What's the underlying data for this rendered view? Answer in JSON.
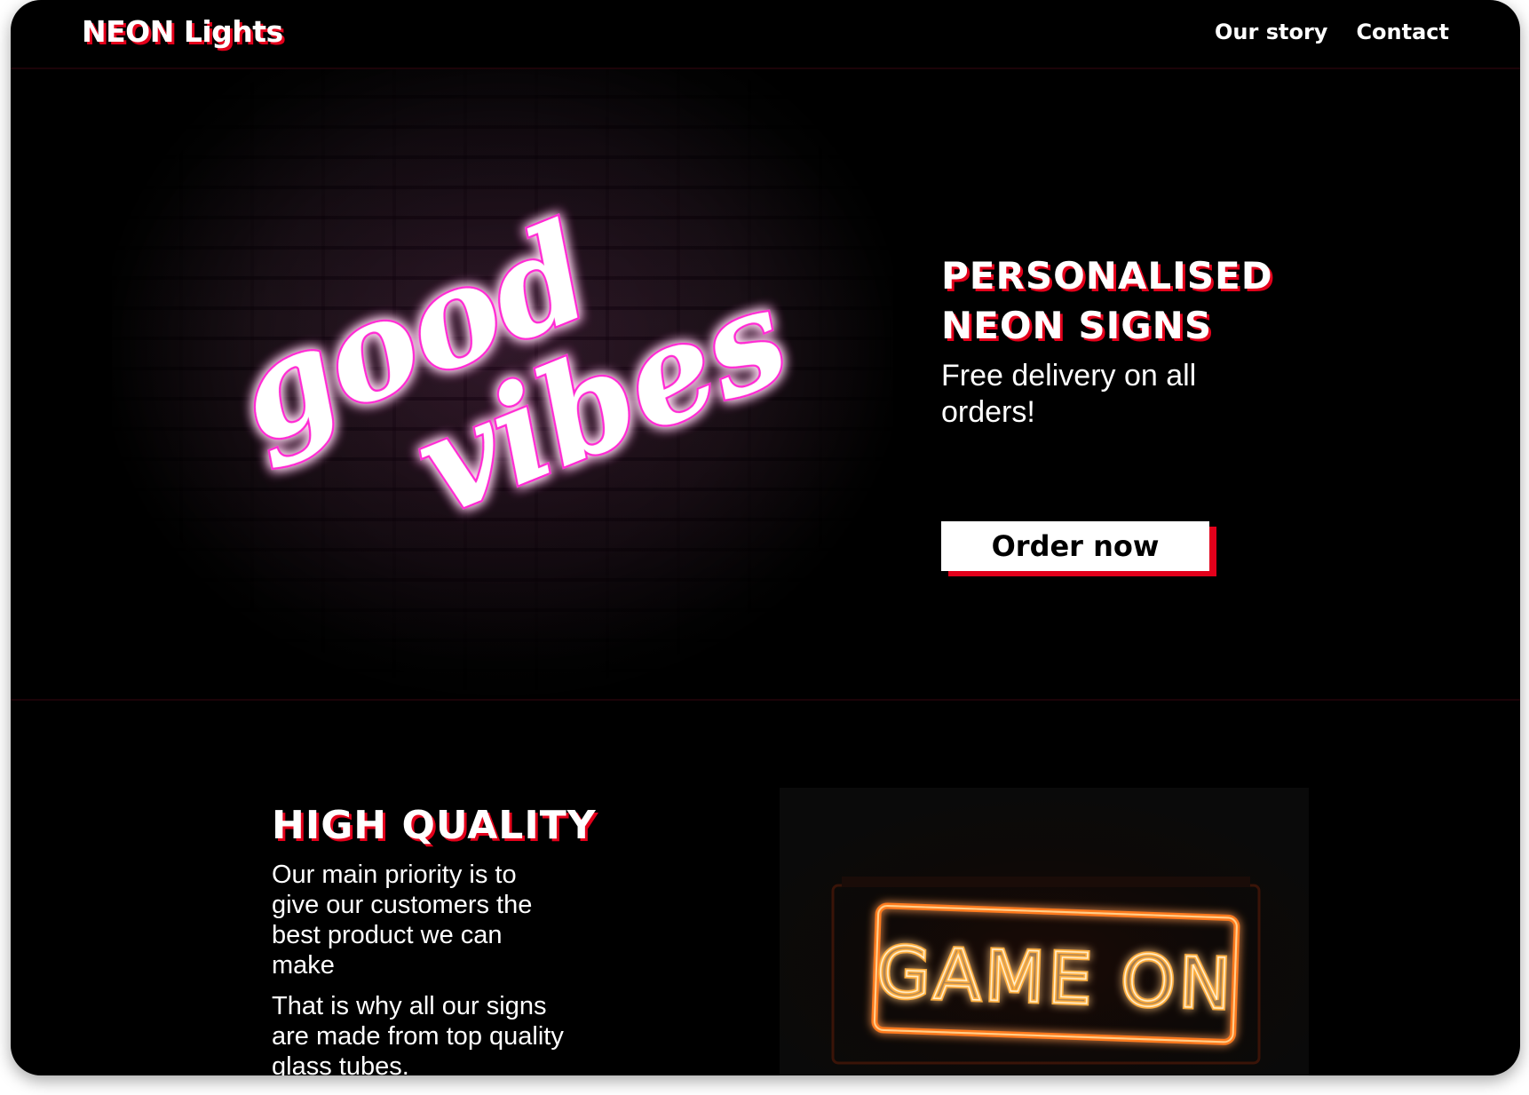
{
  "header": {
    "logo": "NEON Lights",
    "nav": [
      {
        "label": "Our story"
      },
      {
        "label": "Contact"
      }
    ]
  },
  "hero": {
    "sign_line1": "good",
    "sign_line2": "vibes",
    "title_line1": "PERSONALISED",
    "title_line2": "NEON SIGNS",
    "subtitle": "Free delivery on all orders!",
    "cta_label": "Order now"
  },
  "quality": {
    "title": "HIGH QUALITY",
    "paragraph1": "Our main priority is to give our customers the best product we can make",
    "paragraph2": "That is why all our signs are made from top quality glass tubes.",
    "image_sign_text": "GAME ON"
  },
  "colors": {
    "background": "#000000",
    "accent_red": "#e3001b",
    "neon_pink": "#ff2ad4",
    "neon_orange": "#ffae3a",
    "text": "#ffffff"
  },
  "icons": {
    "hero_image": "neon-good-vibes-sign-image",
    "quality_image": "neon-game-on-sign-image"
  }
}
